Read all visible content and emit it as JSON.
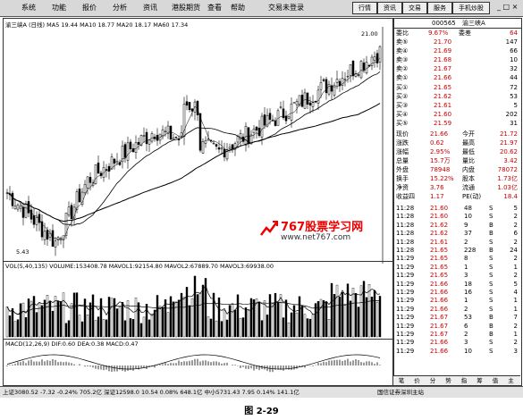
{
  "menu": [
    "系统",
    "功能",
    "报价",
    "分析",
    "资讯",
    "港股期货",
    "查看",
    "帮助",
    "交易未登录"
  ],
  "right_buttons": [
    "行情",
    "资讯",
    "交易",
    "服务",
    "手机炒股"
  ],
  "chart": {
    "header": "渝三峡A (日线) MA5 19.44 MA10 18.77 MA20 18.17 MA60 17.34",
    "high_label": "21.00",
    "low_label": "5.43",
    "volume_header": "VOL(5,40,135) VOLUME:153408.78 MAVOL1:92154.80 MAVOL2:67889.70 MAVOL3:69938.00",
    "macd_header": "MACD(12,26,9) DIF:0.60 DEA:0.38 MACD:0.47"
  },
  "watermark": {
    "title": "767股票学习网",
    "url": "www.net767.com"
  },
  "quote": {
    "code": "000565",
    "name": "渝三峡A",
    "weibi_label": "委比",
    "weibi": "9.67%",
    "weicha_label": "委差",
    "weicha": "64",
    "sells": [
      {
        "l": "卖⑤",
        "p": "21.70",
        "v": "147"
      },
      {
        "l": "卖④",
        "p": "21.69",
        "v": "66"
      },
      {
        "l": "卖③",
        "p": "21.68",
        "v": "10"
      },
      {
        "l": "卖②",
        "p": "21.67",
        "v": "32"
      },
      {
        "l": "卖①",
        "p": "21.66",
        "v": "44"
      }
    ],
    "buys": [
      {
        "l": "买①",
        "p": "21.65",
        "v": "72"
      },
      {
        "l": "买②",
        "p": "21.62",
        "v": "53"
      },
      {
        "l": "买③",
        "p": "21.61",
        "v": "5"
      },
      {
        "l": "买④",
        "p": "21.60",
        "v": "202"
      },
      {
        "l": "买⑤",
        "p": "21.59",
        "v": "31"
      }
    ],
    "stats": [
      {
        "a": "现价",
        "b": "21.66",
        "c": "今开",
        "d": "21.72"
      },
      {
        "a": "涨跌",
        "b": "0.62",
        "c": "最高",
        "d": "21.97"
      },
      {
        "a": "涨幅",
        "b": "2.95%",
        "c": "最低",
        "d": "20.62"
      },
      {
        "a": "总量",
        "b": "15.7万",
        "c": "量比",
        "d": "3.42"
      },
      {
        "a": "外盘",
        "b": "78948",
        "c": "内盘",
        "d": "78072"
      },
      {
        "a": "换手",
        "b": "15.22%",
        "c": "股本",
        "d": "1.73亿"
      },
      {
        "a": "净资",
        "b": "3.76",
        "c": "流通",
        "d": "1.03亿"
      },
      {
        "a": "收益四",
        "b": "1.17",
        "c": "PE(动)",
        "d": "18.4"
      }
    ],
    "ticks": [
      {
        "t": "11:28",
        "p": "21.60",
        "v": "48",
        "s": "S",
        "n": "5"
      },
      {
        "t": "11:28",
        "p": "21.60",
        "v": "10",
        "s": "S",
        "n": "2"
      },
      {
        "t": "11:28",
        "p": "21.62",
        "v": "9",
        "s": "B",
        "n": "2"
      },
      {
        "t": "11:28",
        "p": "21.62",
        "v": "37",
        "s": "B",
        "n": "6"
      },
      {
        "t": "11:28",
        "p": "21.61",
        "v": "2",
        "s": "S",
        "n": "2"
      },
      {
        "t": "11:28",
        "p": "21.65",
        "v": "228",
        "s": "B",
        "n": "24"
      },
      {
        "t": "11:29",
        "p": "21.65",
        "v": "8",
        "s": "S",
        "n": "2"
      },
      {
        "t": "11:29",
        "p": "21.65",
        "v": "1",
        "s": "S",
        "n": "1"
      },
      {
        "t": "11:29",
        "p": "21.65",
        "v": "3",
        "s": "S",
        "n": "2"
      },
      {
        "t": "11:29",
        "p": "21.66",
        "v": "18",
        "s": "S",
        "n": "5"
      },
      {
        "t": "11:29",
        "p": "21.66",
        "v": "16",
        "s": "S",
        "n": "4"
      },
      {
        "t": "11:29",
        "p": "21.66",
        "v": "1",
        "s": "S",
        "n": "1"
      },
      {
        "t": "11:29",
        "p": "21.66",
        "v": "2",
        "s": "S",
        "n": "1"
      },
      {
        "t": "11:29",
        "p": "21.67",
        "v": "53",
        "s": "B",
        "n": "7"
      },
      {
        "t": "11:29",
        "p": "21.67",
        "v": "6",
        "s": "B",
        "n": "2"
      },
      {
        "t": "11:29",
        "p": "21.67",
        "v": "2",
        "s": "B",
        "n": "1"
      },
      {
        "t": "11:29",
        "p": "21.66",
        "v": "3",
        "s": "S",
        "n": "2"
      },
      {
        "t": "11:29",
        "p": "21.66",
        "v": "10",
        "s": "S",
        "n": "3"
      }
    ]
  },
  "tabs": [
    "笔",
    "价",
    "分",
    "势",
    "指",
    "筹",
    "值",
    "主"
  ],
  "status": "上证3080.52  -7.32  -0.24%  705.2亿  深证12598.0  10.54  0.08%  648.1亿  中小5731.43  7.95  0.14%  141.1亿",
  "status_right": "国信证券深圳主站",
  "caption": "图 2-29"
}
